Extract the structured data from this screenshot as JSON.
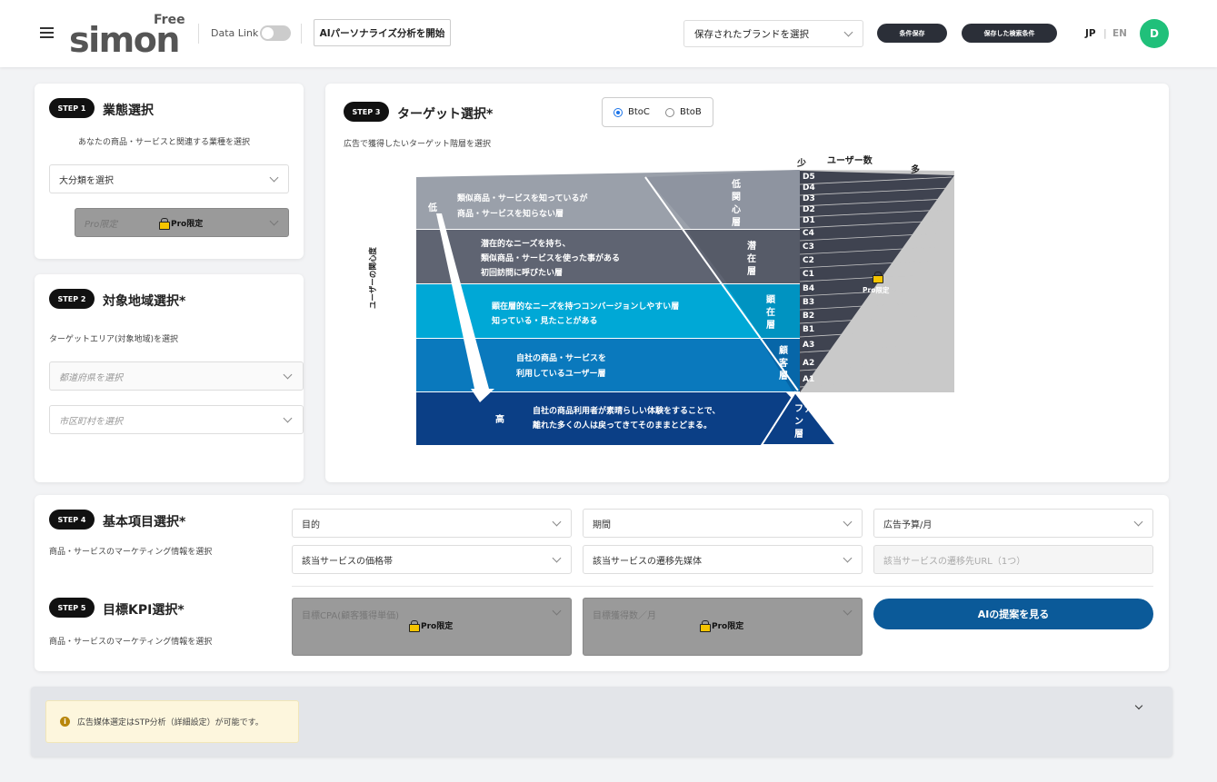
{
  "header": {
    "logo_free": "Free",
    "logo_main": "simon",
    "datalink_label": "Data Link",
    "ai_button": "AIパーソナライズ分析を開始",
    "brand_select": "保存されたブランドを選択",
    "save_conditions": "条件保存",
    "saved_search": "保存した検索条件",
    "lang_jp": "JP",
    "lang_sep": "|",
    "lang_en": "EN",
    "avatar_initial": "D"
  },
  "step1": {
    "badge": "STEP 1",
    "title": "業態選択",
    "desc": "あなたの商品・サービスと関連する業種を選択",
    "category_select": "大分類を選択",
    "pro_placeholder": "Pro限定",
    "pro_label": "Pro限定"
  },
  "step2": {
    "badge": "STEP 2",
    "title": "対象地域選択*",
    "desc": "ターゲットエリア(対象地域)を選択",
    "prefecture_select": "都道府県を選択",
    "city_select": "市区町村を選択"
  },
  "step3": {
    "badge": "STEP 3",
    "title": "ターゲット選択*",
    "desc": "広告で獲得したいターゲット階層を選択",
    "btoc": "BtoC",
    "btob": "BtoB",
    "diagram": {
      "axis_vertical": "ユーザーの関心度",
      "low": "低",
      "high": "高",
      "users_label": "ユーザー数",
      "few": "少",
      "many": "多",
      "pro_label": "Pro限定",
      "rows": [
        {
          "text1": "類似商品・サービスを知っているが",
          "text2": "商品・サービスを知らない層",
          "text3": "",
          "layer": [
            "低",
            "関",
            "心",
            "層"
          ],
          "color": "#9aa0aa"
        },
        {
          "text1": "潜在的なニーズを持ち、",
          "text2": "類似商品・サービスを使った事がある",
          "text3": "初回訪問に呼びたい層",
          "layer": [
            "潜",
            "在",
            "層"
          ],
          "color": "#5f6472"
        },
        {
          "text1": "顕在層的なニーズを持つコンバージョンしやすい層",
          "text2": "知っている・見たことがある",
          "text3": "",
          "layer": [
            "顕",
            "在",
            "層"
          ],
          "color": "#00a8d6"
        },
        {
          "text1": "自社の商品・サービスを",
          "text2": "利用しているユーザー層",
          "text3": "",
          "layer": [
            "顧",
            "客",
            "層"
          ],
          "color": "#0a79bd"
        },
        {
          "text1": "自社の商品利用者が素晴らしい体験をすることで、",
          "text2": "離れた多くの人は戻ってきてそのままとどまる。",
          "text3": "",
          "layer": [
            "ファ",
            "ン",
            "層"
          ],
          "color": "#0b3f86"
        }
      ],
      "codes": [
        "D5",
        "D4",
        "D3",
        "D2",
        "D1",
        "C4",
        "C3",
        "C2",
        "C1",
        "B4",
        "B3",
        "B2",
        "B1",
        "A3",
        "A2",
        "A1"
      ]
    }
  },
  "step4": {
    "badge": "STEP 4",
    "title": "基本項目選択*",
    "desc": "商品・サービスのマーケティング情報を選択",
    "purpose": "目的",
    "period": "期間",
    "budget": "広告予算/月",
    "price_range": "該当サービスの価格帯",
    "destination": "該当サービスの遷移先媒体",
    "url_placeholder": "該当サービスの遷移先URL（1つ）"
  },
  "step5": {
    "badge": "STEP 5",
    "title": "目標KPI選択*",
    "desc": "商品・サービスのマーケティング情報を選択",
    "cpa": "目標CPA(顧客獲得単価)",
    "acquisitions": "目標獲得数／月",
    "pro_label": "Pro限定",
    "submit": "AIの提案を見る"
  },
  "notice": {
    "text": "広告媒体選定はSTP分析（詳細設定）が可能です。",
    "icon": "i"
  }
}
